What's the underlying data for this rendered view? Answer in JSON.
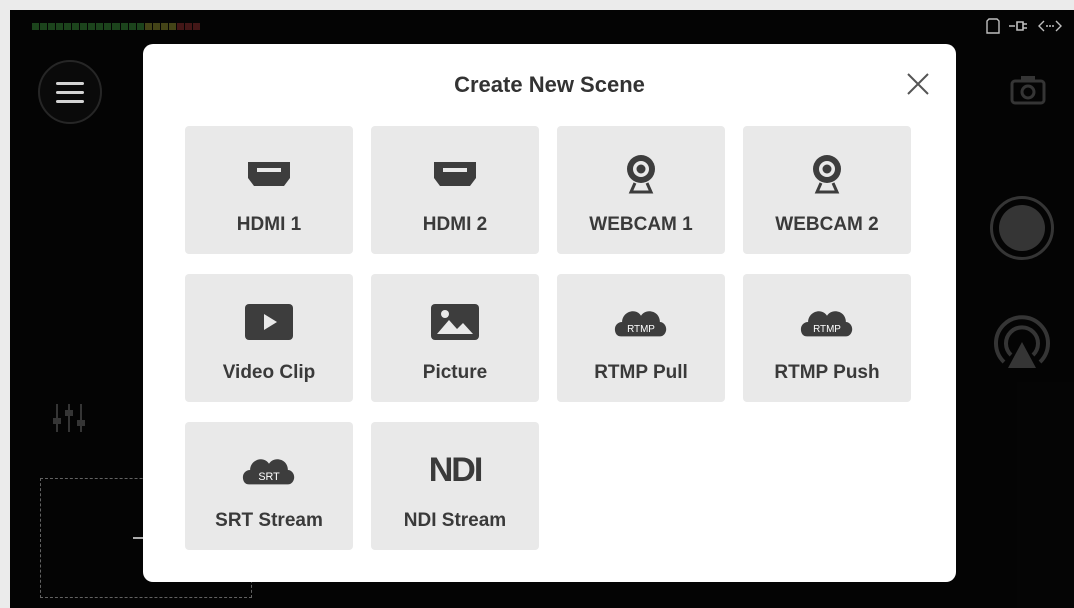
{
  "dialog": {
    "title": "Create New Scene"
  },
  "sources": [
    {
      "label": "HDMI 1",
      "icon": "hdmi-icon"
    },
    {
      "label": "HDMI 2",
      "icon": "hdmi-icon"
    },
    {
      "label": "WEBCAM 1",
      "icon": "webcam-icon"
    },
    {
      "label": "WEBCAM 2",
      "icon": "webcam-icon"
    },
    {
      "label": "Video Clip",
      "icon": "play-icon"
    },
    {
      "label": "Picture",
      "icon": "picture-icon"
    },
    {
      "label": "RTMP Pull",
      "icon": "rtmp-cloud-icon",
      "badge": "RTMP"
    },
    {
      "label": "RTMP Push",
      "icon": "rtmp-cloud-icon",
      "badge": "RTMP"
    },
    {
      "label": "SRT Stream",
      "icon": "srt-cloud-icon",
      "badge": "SRT"
    },
    {
      "label": "NDI Stream",
      "icon": "ndi-logo-icon",
      "badge": "NDI"
    }
  ],
  "colors": {
    "tile_bg": "#e9e9e9",
    "icon": "#3d3d3d",
    "title": "#333333",
    "screen_bg": "#050505"
  }
}
